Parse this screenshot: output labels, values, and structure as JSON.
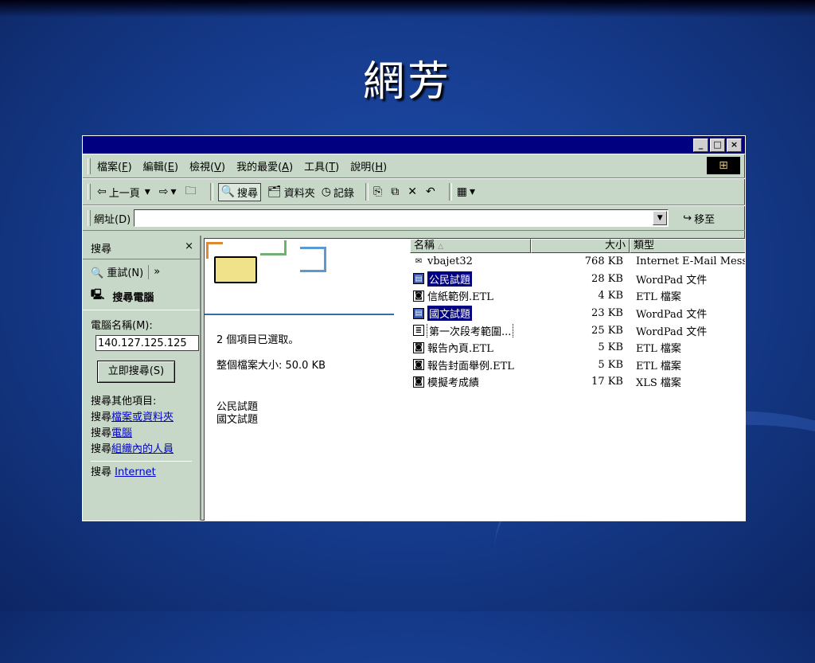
{
  "slide": {
    "title": "網芳"
  },
  "window": {
    "controls": {
      "minimize": "_",
      "maximize": "□",
      "close": "×"
    },
    "menu": [
      {
        "label": "檔案(",
        "key": "F",
        "end": ")"
      },
      {
        "label": "編輯(",
        "key": "E",
        "end": ")"
      },
      {
        "label": "檢視(",
        "key": "V",
        "end": ")"
      },
      {
        "label": "我的最愛(",
        "key": "A",
        "end": ")"
      },
      {
        "label": "工具(",
        "key": "T",
        "end": ")"
      },
      {
        "label": "說明(",
        "key": "H",
        "end": ")"
      }
    ],
    "toolbar": {
      "back": "上一頁",
      "search": "搜尋",
      "folders": "資料夾",
      "history": "記錄"
    },
    "address": {
      "label": "網址(D)",
      "value": "",
      "go": "移至"
    }
  },
  "search_panel": {
    "title": "搜尋",
    "close": "×",
    "retry": "重試(N)",
    "more": "»",
    "computer_heading": "搜尋電腦",
    "name_label": "電腦名稱(M):",
    "name_value": "140.127.125.125",
    "search_now": "立即搜尋(S)",
    "other_heading": "搜尋其他項目:",
    "other_prefix": "搜尋",
    "links": [
      "檔案或資料夾",
      "電腦",
      "組織內的人員",
      "Internet"
    ]
  },
  "info_panel": {
    "selected_count": "2 個項目已選取。",
    "total_size": "整個檔案大小: 50.0 KB",
    "selected_files": [
      "公民試題",
      "國文試題"
    ]
  },
  "file_list": {
    "columns": {
      "name": "名稱",
      "size": "大小",
      "type": "類型"
    },
    "rows": [
      {
        "name": "vbajet32",
        "size": "768 KB",
        "type": "Internet E-Mail Mess...",
        "icon": "mail-icon",
        "state": ""
      },
      {
        "name": "公民試題",
        "size": "28 KB",
        "type": "WordPad 文件",
        "icon": "wordpad-icon",
        "state": "selected"
      },
      {
        "name": "信紙範例.ETL",
        "size": "4 KB",
        "type": "ETL 檔案",
        "icon": "etl-icon",
        "state": ""
      },
      {
        "name": "國文試題",
        "size": "23 KB",
        "type": "WordPad 文件",
        "icon": "wordpad-icon",
        "state": "selected"
      },
      {
        "name": "第一次段考範圍...",
        "size": "25 KB",
        "type": "WordPad 文件",
        "icon": "document-icon",
        "state": "focus"
      },
      {
        "name": "報告內頁.ETL",
        "size": "5 KB",
        "type": "ETL 檔案",
        "icon": "etl-icon",
        "state": ""
      },
      {
        "name": "報告封面舉例.ETL",
        "size": "5 KB",
        "type": "ETL 檔案",
        "icon": "etl-icon",
        "state": ""
      },
      {
        "name": "模擬考成績",
        "size": "17 KB",
        "type": "XLS 檔案",
        "icon": "etl-icon",
        "state": ""
      }
    ]
  },
  "colors": {
    "slide_bg": "#153a8a",
    "titlebar": "#000080",
    "chrome": "#c8d8c8",
    "selection": "#000080",
    "link": "#0000cc"
  }
}
